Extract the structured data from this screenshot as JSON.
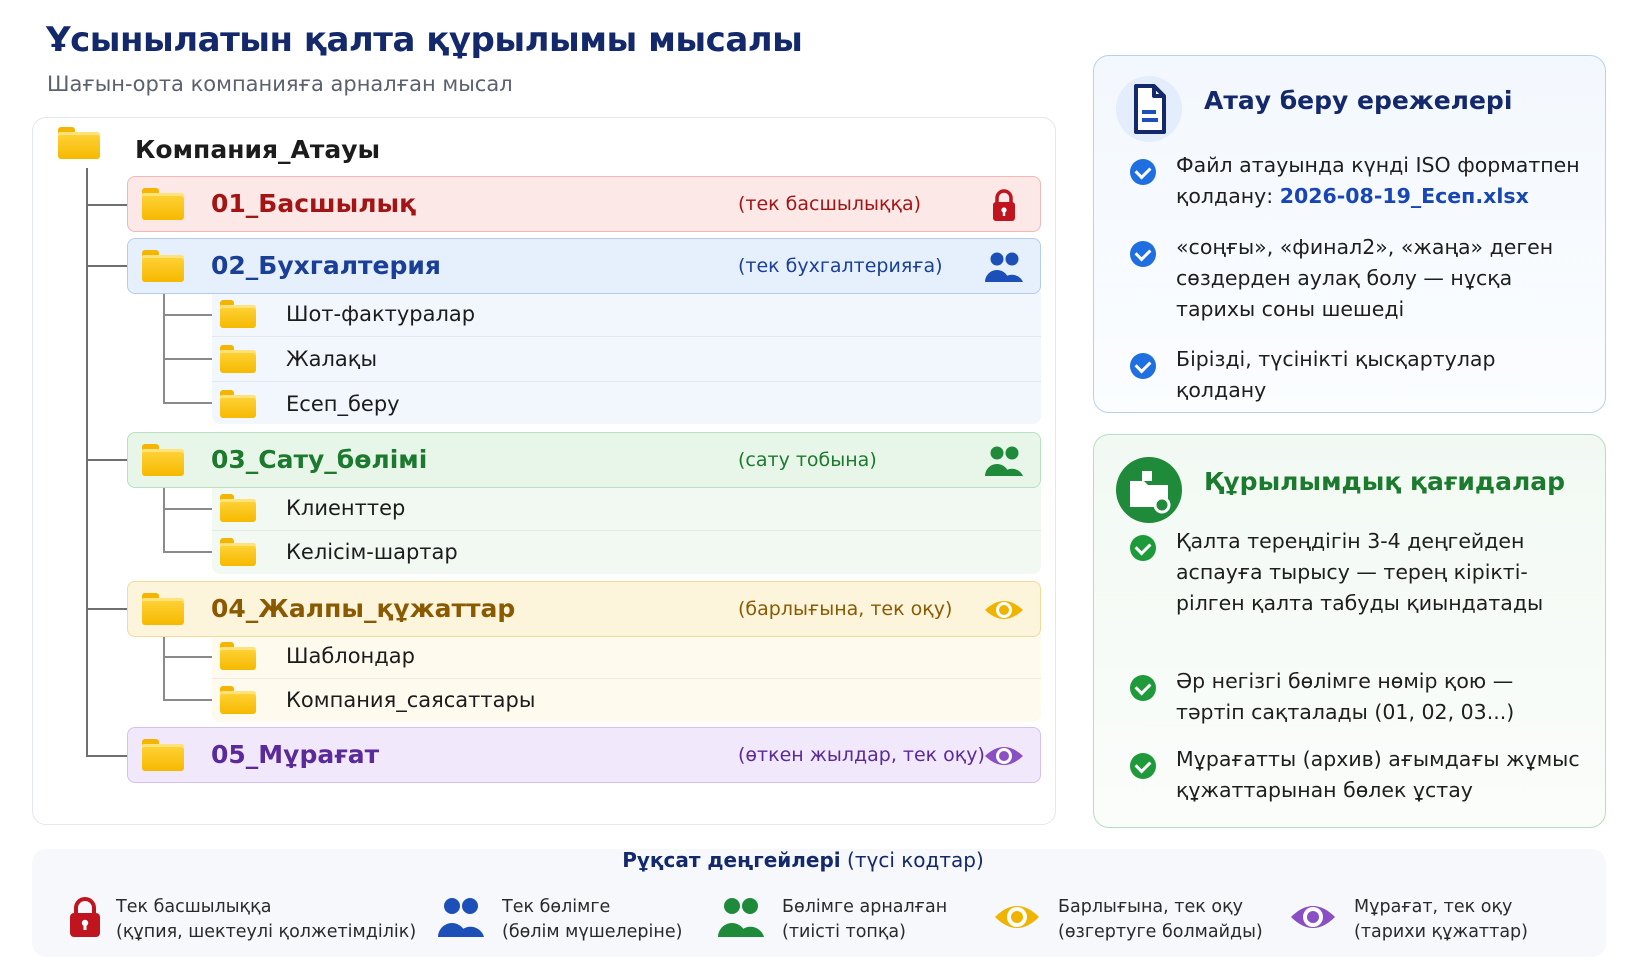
{
  "header": {
    "title": "Ұсынылатын қалта құрылымы мысалы",
    "subtitle": "Шағын-орта компанияға арналған мысал"
  },
  "tree": {
    "root": "Компания_Атауы",
    "sections": [
      {
        "label": "01_Басшылық",
        "note": "(тек басшылыққа)",
        "icon": "lock-icon",
        "color": "#a31515",
        "bg": "#fde8e8",
        "border": "#f1b8b8",
        "children": []
      },
      {
        "label": "02_Бухгалтерия",
        "note": "(тек бухгалтерияға)",
        "icon": "users-icon",
        "color": "#1a3f96",
        "bg": "#e6f0fd",
        "border": "#b4ccee",
        "children": [
          "Шот-фактуралар",
          "Жалақы",
          "Есеп_беру"
        ]
      },
      {
        "label": "03_Сату_бөлімі",
        "note": "(сату тобына)",
        "icon": "users-icon",
        "color": "#1c7a2e",
        "bg": "#e8f6ea",
        "border": "#b9e0c0",
        "children": [
          "Клиенттер",
          "Келісім-шартар"
        ]
      },
      {
        "label": "04_Жалпы_құжаттар",
        "note": "(барлығына, тек оқу)",
        "icon": "eye-icon",
        "color": "#8a5a00",
        "bg": "#fdf4dc",
        "border": "#f3d99a",
        "children": [
          "Шаблондар",
          "Компания_саясаттары"
        ]
      },
      {
        "label": "05_Мұрағат",
        "note": "(өткен жылдар, тек оқу)",
        "icon": "eye-icon",
        "color": "#5a2a9a",
        "bg": "#f1e8fb",
        "border": "#d6c0ef",
        "children": []
      }
    ]
  },
  "naming_card": {
    "title": "Атау беру ережелері",
    "icon": "document-icon",
    "bullets": [
      {
        "text": "Файл атауында күнді ISO форматпен қолдану: ",
        "highlight": "2026-08-19_Есеп.xlsx"
      },
      {
        "text": "«соңғы», «финал2», «жаңа» деген сөздерден аулақ болу — нұсқа тарихы соны шешеді",
        "highlight": ""
      },
      {
        "text": "Бірізді, түсінікті қысқартулар қолдану",
        "highlight": ""
      }
    ]
  },
  "structure_card": {
    "title": "Құрылымдық қағидалар",
    "icon": "folder-structure-icon",
    "bullets": [
      {
        "text": "Қалта тереңдігін 3-4 деңгейден аспауға тырысу — терең кірікті­рілген қалта табуды қиындатады",
        "highlight": ""
      },
      {
        "text": "Әр негізгі бөлімге нөмір қою — тәртіп сақталады (01, 02, 03...)",
        "highlight": ""
      },
      {
        "text": "Мұрағатты (архив) ағымдағы жұмыс құжаттарынан бөлек ұстау",
        "highlight": ""
      }
    ]
  },
  "legend": {
    "title_bold": "Рұқсат деңгейлері",
    "title_rest": " (түсі кодтар)",
    "items": [
      {
        "icon": "lock-icon",
        "color": "#c0141e",
        "line1": "Тек басшылыққа",
        "line2": "(құпия, шектеулі қолжетімділік)"
      },
      {
        "icon": "users-icon",
        "color": "#1d4fb8",
        "line1": "Тек бөлімге",
        "line2": "(бөлім мүшелеріне)"
      },
      {
        "icon": "users-icon",
        "color": "#1f8a3a",
        "line1": "Бөлімге арналған",
        "line2": "(тиісті топқа)"
      },
      {
        "icon": "eye-icon",
        "color": "#f0b400",
        "line1": "Барлығына, тек оқу",
        "line2": "(өзгертуге болмайды)"
      },
      {
        "icon": "eye-icon",
        "color": "#8a4fc4",
        "line1": "Мұрағат, тек оқу",
        "line2": "(тарихи құжаттар)"
      }
    ]
  },
  "colors": {
    "navy": "#13296b",
    "blue_card_border": "#b8d0ef",
    "green_card_border": "#b7ddbf",
    "blue_bullet": "#1f6fe0",
    "green_bullet": "#1f9a3a"
  }
}
